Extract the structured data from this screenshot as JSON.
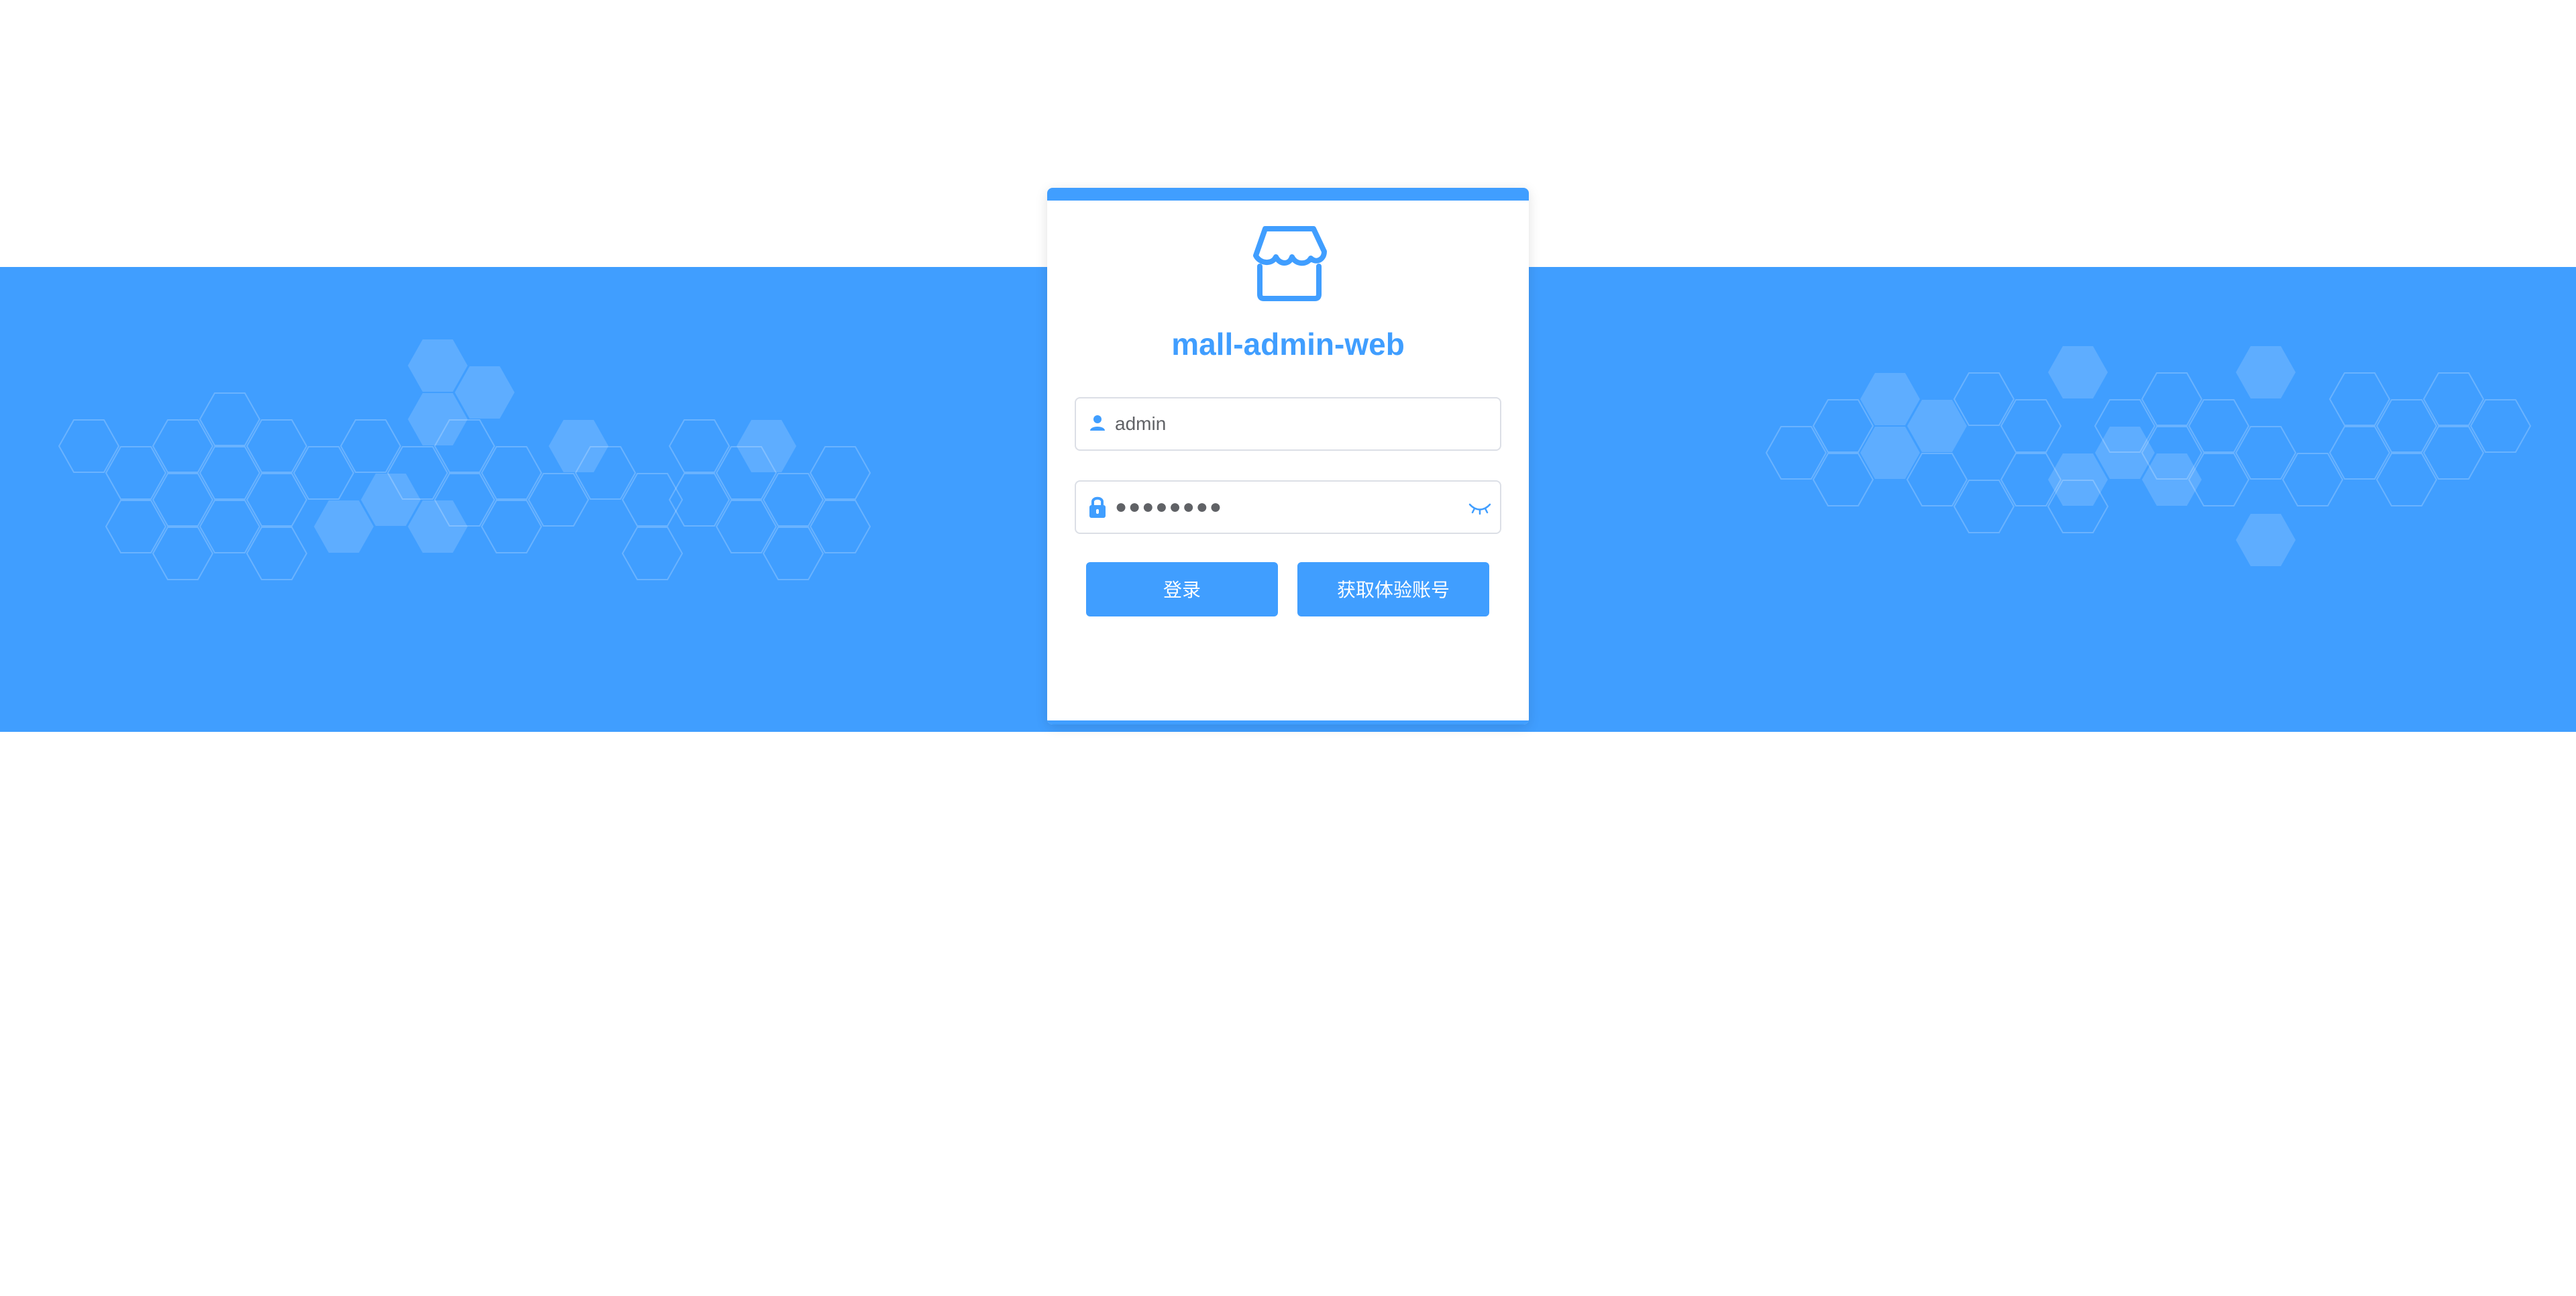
{
  "app": {
    "title": "mall-admin-web",
    "logo_icon": "shop-icon"
  },
  "colors": {
    "accent": "#409eff",
    "banner": "#409eff",
    "input_border": "#dcdfe6",
    "text": "#606266"
  },
  "login_form": {
    "username": {
      "value": "admin",
      "icon": "user-icon"
    },
    "password": {
      "value": "●●●●●●●●",
      "icon": "lock-icon",
      "toggle_icon": "eye-closed-icon"
    },
    "login_button": "登录",
    "demo_account_button": "获取体验账号"
  }
}
